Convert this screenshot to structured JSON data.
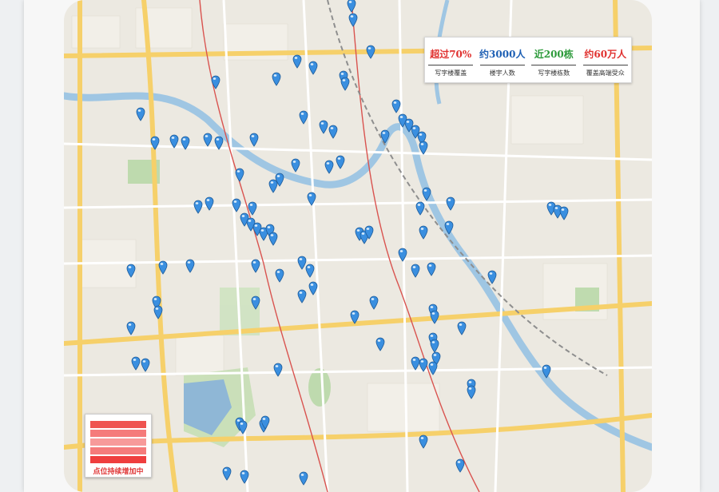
{
  "stats": [
    {
      "value": "超过70%",
      "label": "写字楼覆盖",
      "color": "#e0312f"
    },
    {
      "value": "约3000人",
      "label": "楼宇人数",
      "color": "#1d5fb4"
    },
    {
      "value": "近200栋",
      "label": "写字楼栋数",
      "color": "#2c9a3a"
    },
    {
      "value": "约60万人",
      "label": "覆盖高端受众",
      "color": "#e0312f"
    }
  ],
  "legend": {
    "caption": "点位持续增加中",
    "colors": [
      "#ef5350",
      "#f57b7b",
      "#f79a9a",
      "#f57b7b",
      "#ef3e3e"
    ]
  },
  "colors": {
    "pin": "#3a8fe0",
    "river": "#9fc6e3",
    "road": "#f6d06a",
    "park": "#b9d8a8"
  },
  "icons": {
    "pin": "map-pin-icon"
  }
}
